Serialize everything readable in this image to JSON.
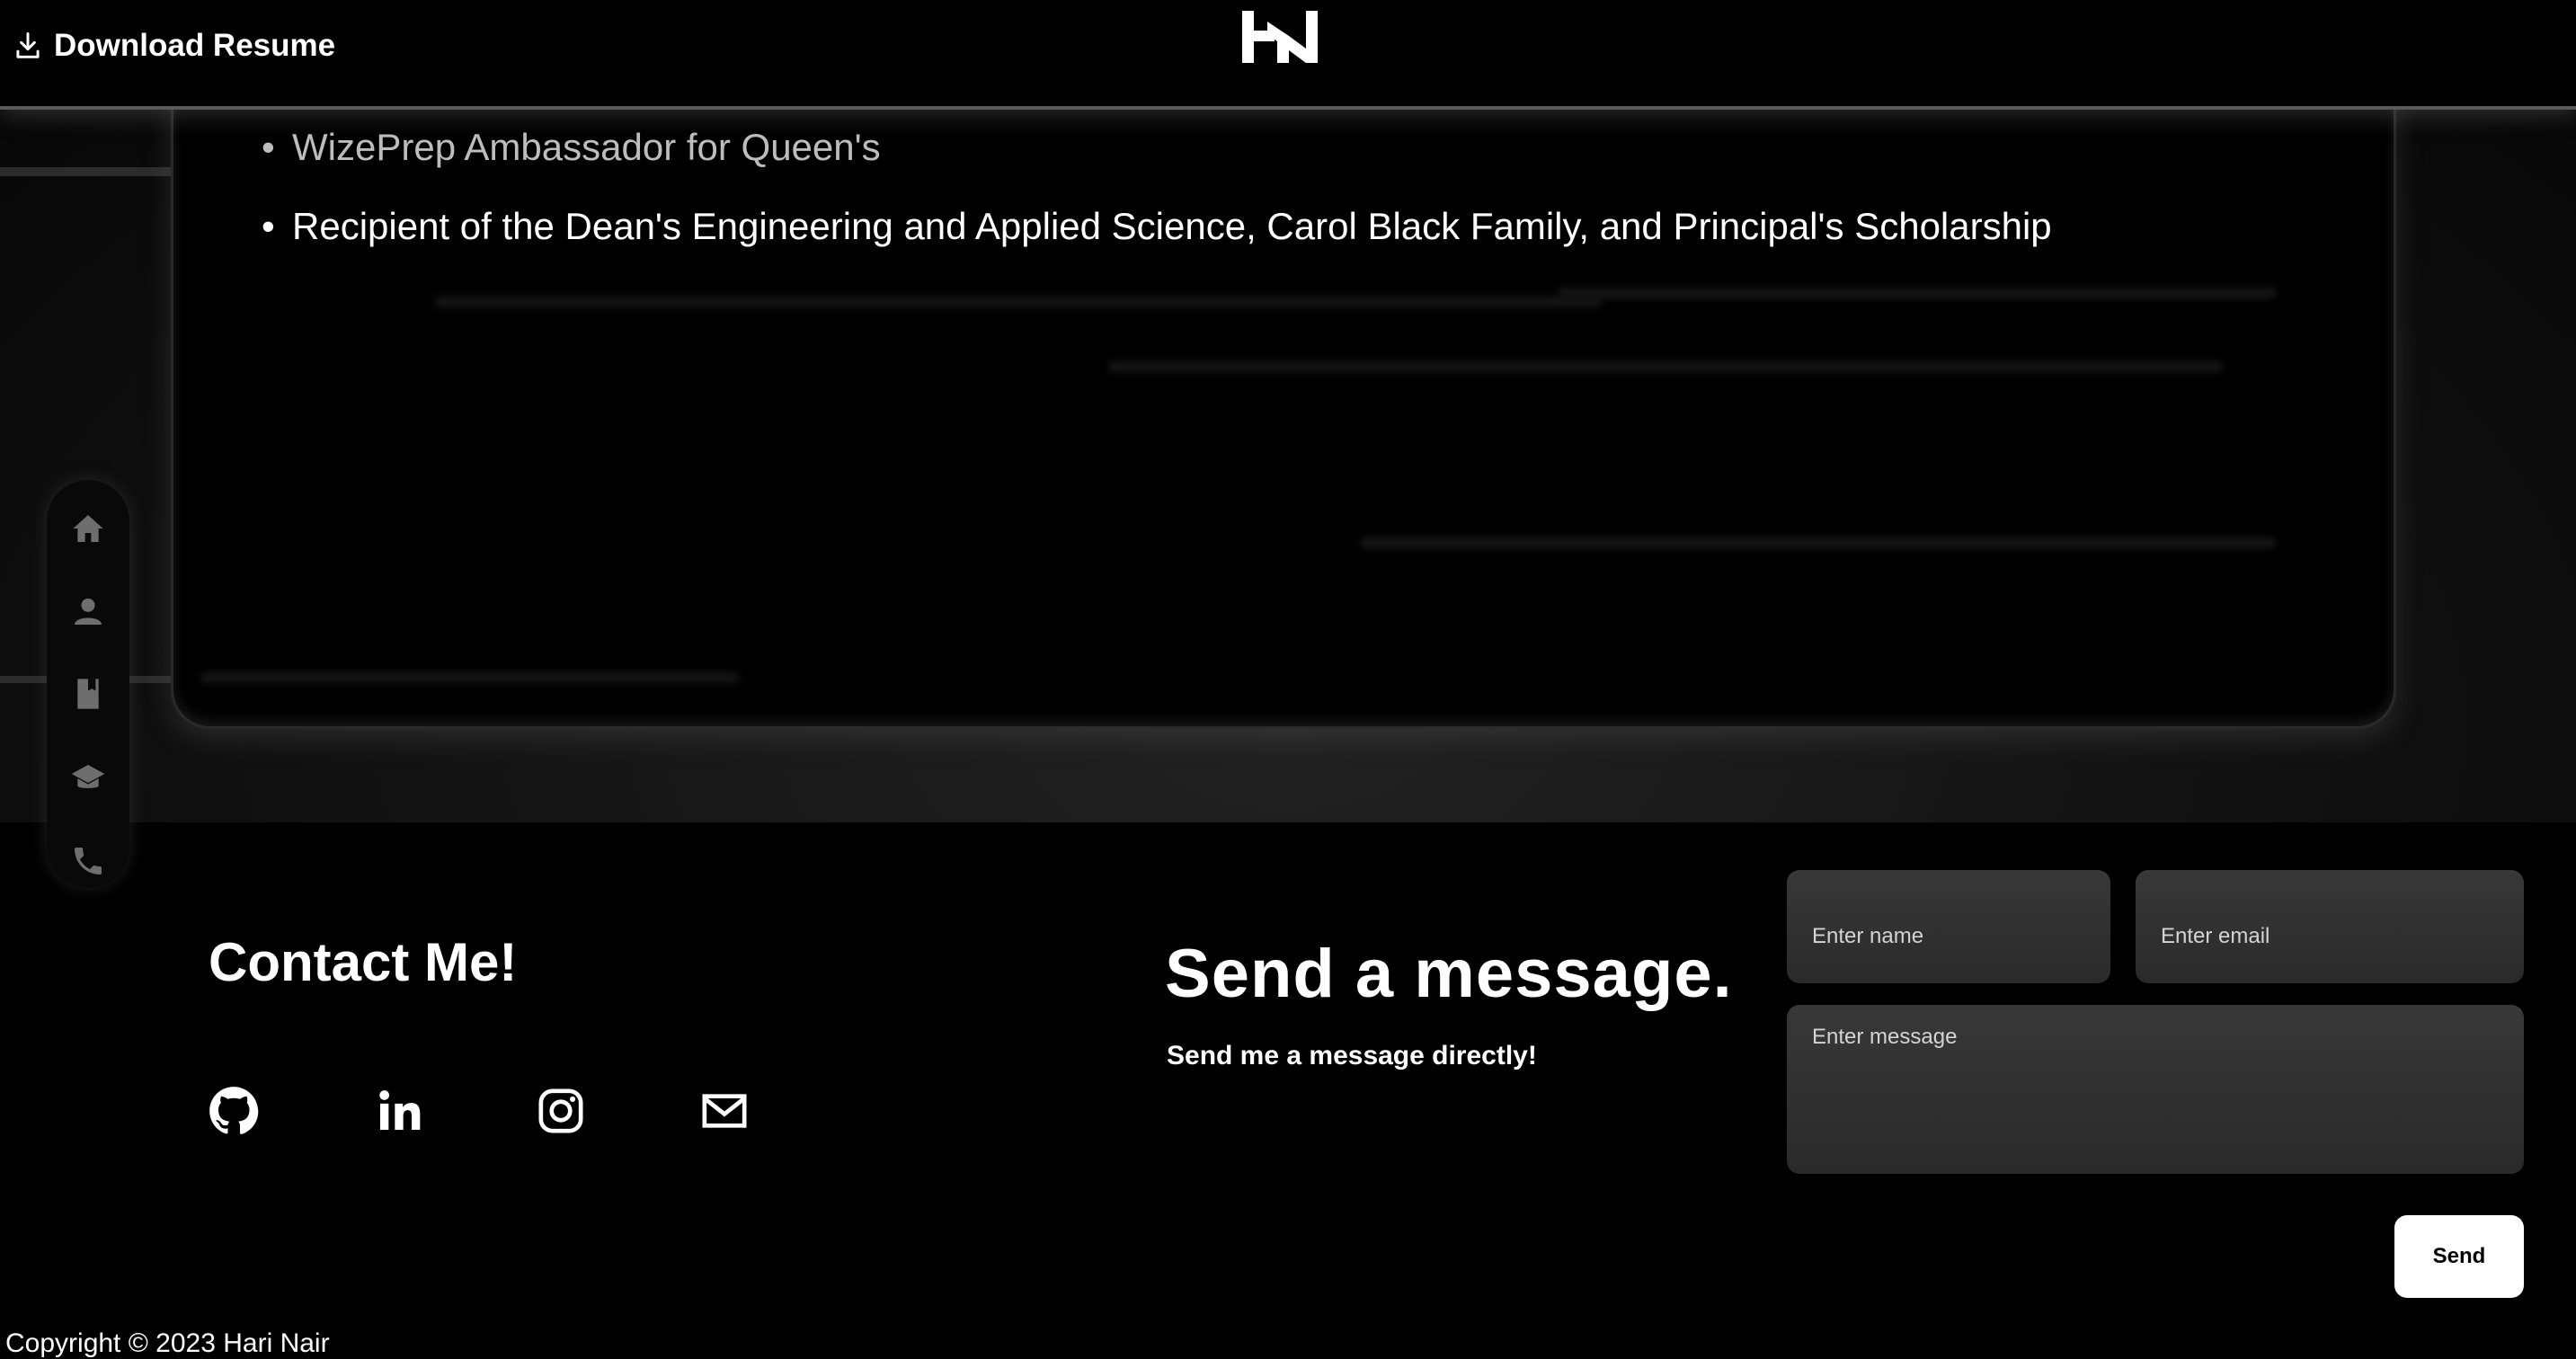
{
  "header": {
    "download_label": "Download Resume"
  },
  "card": {
    "bullets": [
      "WizePrep Ambassador for Queen's",
      "Recipient of the Dean's Engineering and Applied Science, Carol Black Family, and Principal's Scholarship"
    ]
  },
  "sidenav": {
    "items": [
      {
        "icon": "home-icon"
      },
      {
        "icon": "person-icon"
      },
      {
        "icon": "book-icon"
      },
      {
        "icon": "graduation-cap-icon"
      },
      {
        "icon": "phone-icon"
      }
    ]
  },
  "contact": {
    "title": "Contact Me!",
    "socials": [
      {
        "icon": "github-icon"
      },
      {
        "icon": "linkedin-icon"
      },
      {
        "icon": "instagram-icon"
      },
      {
        "icon": "mail-icon"
      }
    ]
  },
  "message": {
    "title": "Send a message.",
    "subtitle": "Send me a message directly!",
    "name_placeholder": "Enter name",
    "email_placeholder": "Enter email",
    "message_placeholder": "Enter message",
    "send_label": "Send"
  },
  "footer": {
    "copyright": "Copyright © 2023 Hari Nair"
  },
  "colors": {
    "background": "#000000",
    "text": "#ffffff",
    "field": "#333333",
    "nav_icon": "#6e6e6e"
  }
}
